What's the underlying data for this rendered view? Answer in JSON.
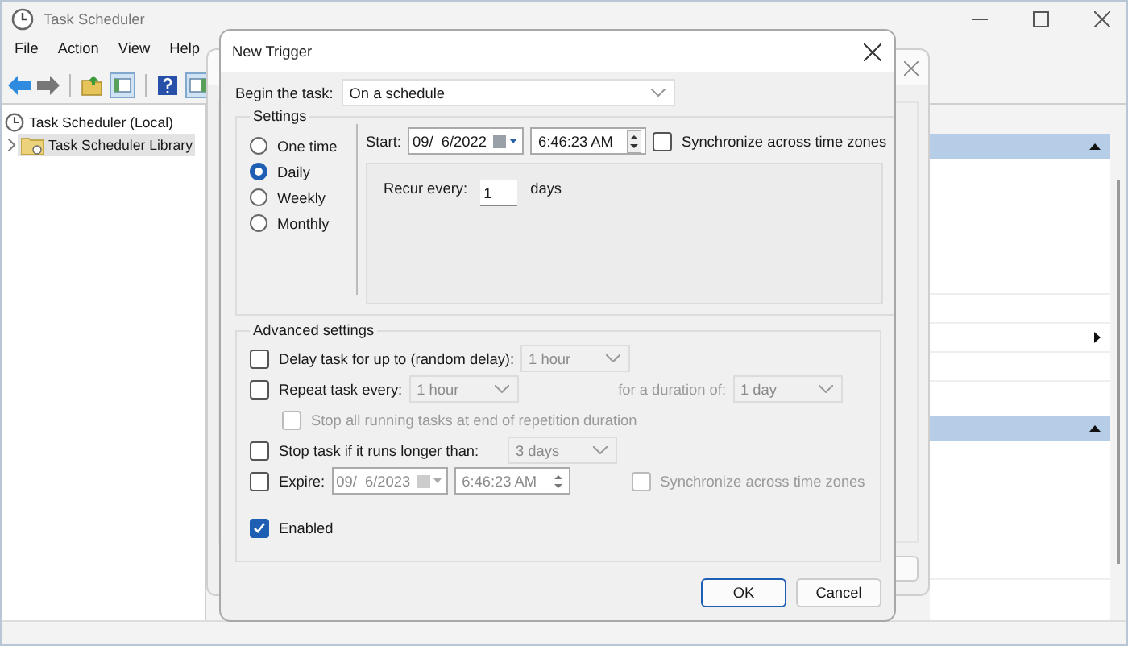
{
  "window": {
    "title": "Task Scheduler"
  },
  "menu": [
    {
      "label": "File"
    },
    {
      "label": "Action"
    },
    {
      "label": "View"
    },
    {
      "label": "Help"
    }
  ],
  "tree": [
    {
      "label": "Task Scheduler (Local)",
      "selected": false,
      "children": [
        {
          "label": "Task Scheduler Library",
          "selected": true,
          "expanded": false
        }
      ]
    }
  ],
  "dialog": {
    "title": "New Trigger",
    "begin_task": {
      "label": "Begin the task:",
      "value": "On a schedule"
    },
    "settings": {
      "title": "Settings",
      "schedule_options": [
        {
          "label": "One time",
          "selected": false
        },
        {
          "label": "Daily",
          "selected": true
        },
        {
          "label": "Weekly",
          "selected": false
        },
        {
          "label": "Monthly",
          "selected": false
        }
      ],
      "start": {
        "label": "Start:",
        "date": "09/  6/2022",
        "time": "6:46:23 AM"
      },
      "sync": {
        "label": "Synchronize across time zones",
        "checked": false
      },
      "recur": {
        "label": "Recur every:",
        "value": "1",
        "unit": "days"
      }
    },
    "advanced": {
      "title": "Advanced settings",
      "delay": {
        "label": "Delay task for up to (random delay):",
        "checked": false,
        "value": "1 hour",
        "disabled": true
      },
      "repeat": {
        "label": "Repeat task every:",
        "checked": false,
        "value": "1 hour",
        "disabled": true,
        "duration_label": "for a duration of:",
        "duration": "1 day"
      },
      "stop_all": {
        "label": "Stop all running tasks at end of repetition duration",
        "checked": false,
        "disabled": true
      },
      "stop_longer": {
        "label": "Stop task if it runs longer than:",
        "checked": false,
        "value": "3 days",
        "disabled": true
      },
      "expire": {
        "label": "Expire:",
        "checked": false,
        "date": "09/  6/2023",
        "time": "6:46:23 AM",
        "disabled": true,
        "sync_label": "Synchronize across time zones",
        "sync_checked": false
      },
      "enabled": {
        "label": "Enabled",
        "checked": true
      }
    },
    "buttons": [
      {
        "label": "OK",
        "default": true
      },
      {
        "label": "Cancel",
        "default": false
      }
    ]
  }
}
